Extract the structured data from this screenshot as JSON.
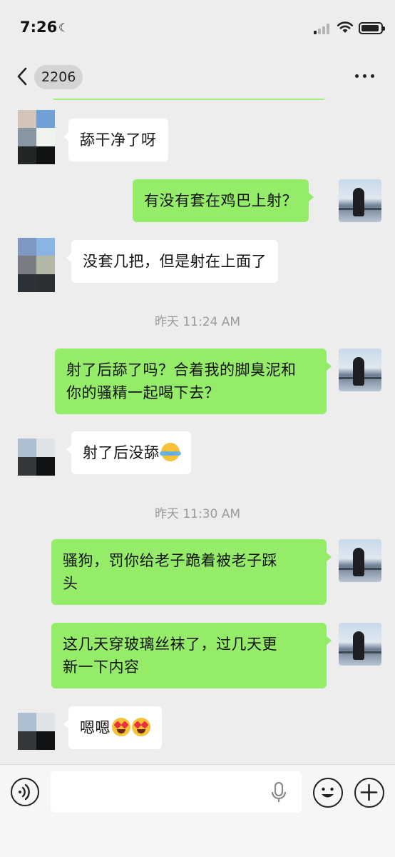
{
  "status_bar": {
    "time": "7:26"
  },
  "nav": {
    "title": "2206"
  },
  "messages": [
    {
      "side": "left",
      "text": "舔干净了呀"
    },
    {
      "side": "right",
      "text": "有没有套在鸡巴上射？"
    },
    {
      "side": "left",
      "text": "没套几把，但是射在上面了"
    },
    {
      "timestamp": "昨天 11:24 AM"
    },
    {
      "side": "right",
      "text_line1": "射了后舔了吗？合着我的脚臭泥和",
      "text_line2": "你的骚精一起喝下去？"
    },
    {
      "side": "left",
      "text": "射了后没舔"
    },
    {
      "timestamp": "昨天 11:30 AM"
    },
    {
      "side": "right",
      "text_line1": "骚狗，罚你给老子跪着被老子踩",
      "text_line2": "头"
    },
    {
      "side": "right",
      "text_line1": "这几天穿玻璃丝袜了，过几天更",
      "text_line2": "新一下内容"
    },
    {
      "side": "left",
      "text": "嗯嗯"
    }
  ],
  "icons": {
    "back": "chevron-left-icon",
    "more": "more-icon",
    "voice": "voice-icon",
    "mic": "mic-icon",
    "emoji": "emoji-icon",
    "plus": "plus-icon",
    "moon": "moon-icon"
  },
  "colors": {
    "background": "#ededed",
    "bubble_self": "#95ec69",
    "bubble_other": "#ffffff",
    "timestamp": "#9a9a9a"
  }
}
